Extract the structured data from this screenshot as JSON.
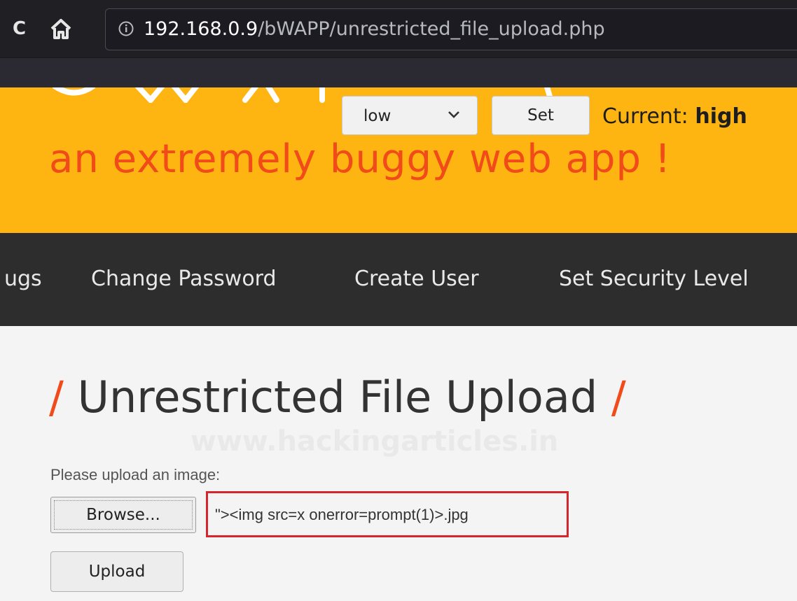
{
  "browser": {
    "reload_icon": "reload-icon",
    "home_icon": "home-icon",
    "info_icon": "info-icon",
    "url_host": "192.168.0.9",
    "url_path": "/bWAPP/unrestricted_file_upload.php"
  },
  "header": {
    "security_select_value": "low",
    "set_button_label": "Set",
    "current_label": "Current:",
    "current_value": "high",
    "tagline": "an extremely buggy web app !",
    "brand_color": "#ffb511",
    "accent_color": "#f14b1a"
  },
  "nav": {
    "items": [
      {
        "label": "ugs"
      },
      {
        "label": "Change Password"
      },
      {
        "label": "Create User"
      },
      {
        "label": "Set Security Level"
      }
    ]
  },
  "main": {
    "title_slash_left": "/",
    "title": "Unrestricted File Upload",
    "title_slash_right": "/",
    "watermark": "www.hackingarticles.in",
    "upload_prompt": "Please upload an image:",
    "browse_label": "Browse...",
    "selected_filename": "\"><img src=x onerror=prompt(1)>.jpg",
    "upload_label": "Upload",
    "highlight_color": "#d6252d"
  }
}
